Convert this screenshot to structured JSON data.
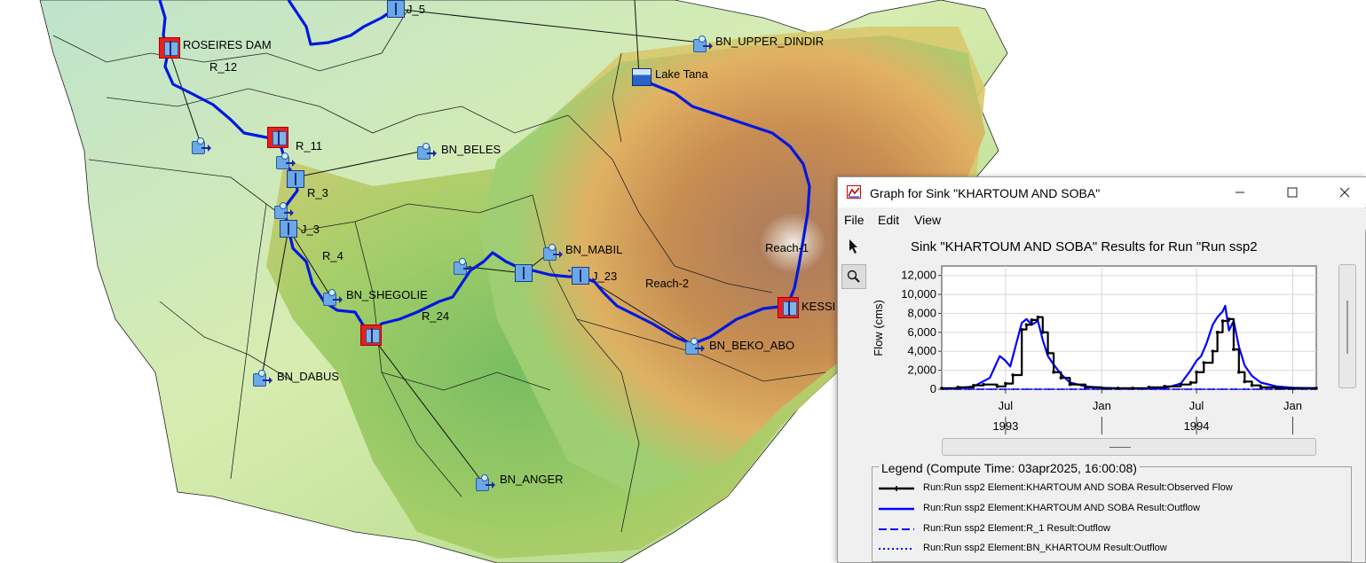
{
  "map": {
    "labels": {
      "roseires_dam": "ROSEIRES DAM",
      "r_12": "R_12",
      "j_5": "J_5",
      "bn_upper_dindir": "BN_UPPER_DINDIR",
      "lake_tana": "Lake Tana",
      "r_11": "R_11",
      "bn_beles": "BN_BELES",
      "r_3": "R_3",
      "j_3": "J_3",
      "r_4": "R_4",
      "bn_shegolie": "BN_SHEGOLIE",
      "r_24": "R_24",
      "bn_mabil": "BN_MABIL",
      "j_23": "J_23",
      "reach_2": "Reach-2",
      "reach_1": "Reach-1",
      "kessie": "KESSI",
      "bn_beko_abo": "BN_BEKO_ABO",
      "bn_dabus": "BN_DABUS",
      "bn_anger": "BN_ANGER"
    }
  },
  "graph_window": {
    "title": "Graph for Sink \"KHARTOUM AND SOBA\"",
    "menu": [
      "File",
      "Edit",
      "View"
    ],
    "chart_title": "Sink \"KHARTOUM AND SOBA\" Results for Run \"Run ssp2",
    "legend_title": "Legend (Compute Time: 03apr2025, 16:00:08)",
    "legend": [
      {
        "label": "Run:Run ssp2 Element:KHARTOUM AND SOBA Result:Observed Flow",
        "color": "#000000",
        "style": "solid-markers"
      },
      {
        "label": "Run:Run ssp2 Element:KHARTOUM AND SOBA Result:Outflow",
        "color": "#0000ff",
        "style": "solid"
      },
      {
        "label": "Run:Run ssp2 Element:R_1 Result:Outflow",
        "color": "#0000ff",
        "style": "dashed"
      },
      {
        "label": "Run:Run ssp2 Element:BN_KHARTOUM Result:Outflow",
        "color": "#0000ff",
        "style": "dotted"
      }
    ]
  },
  "chart_data": {
    "type": "line",
    "title": "Sink \"KHARTOUM AND SOBA\" Results for Run \"Run ssp2",
    "ylabel": "Flow (cms)",
    "ylim": [
      0,
      13000
    ],
    "yticks": [
      0,
      2000,
      4000,
      6000,
      8000,
      10000,
      12000
    ],
    "ytick_labels": [
      "0",
      "2,000",
      "4,000",
      "6,000",
      "8,000",
      "10,000",
      "12,000"
    ],
    "xlim": [
      "1993-03-01",
      "1995-02-15"
    ],
    "xticks": [
      {
        "date": "1993-07-01",
        "label": "Jul",
        "year": "1993"
      },
      {
        "date": "1994-01-01",
        "label": "Jan",
        "year": ""
      },
      {
        "date": "1994-07-01",
        "label": "Jul",
        "year": "1994"
      },
      {
        "date": "1995-01-01",
        "label": "Jan",
        "year": ""
      }
    ],
    "grid": true,
    "series": [
      {
        "name": "Run:Run ssp2 Element:KHARTOUM AND SOBA Result:Observed Flow",
        "color": "#000000",
        "x": [
          "1993-03-01",
          "1993-04-01",
          "1993-05-01",
          "1993-05-20",
          "1993-06-15",
          "1993-07-01",
          "1993-07-15",
          "1993-08-01",
          "1993-08-10",
          "1993-08-20",
          "1993-09-01",
          "1993-09-10",
          "1993-09-20",
          "1993-10-01",
          "1993-10-15",
          "1993-11-01",
          "1993-12-01",
          "1994-01-01",
          "1994-02-01",
          "1994-03-01",
          "1994-04-01",
          "1994-05-01",
          "1994-06-01",
          "1994-06-20",
          "1994-07-01",
          "1994-07-15",
          "1994-08-01",
          "1994-08-10",
          "1994-08-20",
          "1994-09-01",
          "1994-09-10",
          "1994-09-20",
          "1994-10-01",
          "1994-10-15",
          "1994-11-01",
          "1994-12-01",
          "1995-01-01",
          "1995-02-15"
        ],
        "values": [
          100,
          200,
          400,
          500,
          300,
          600,
          1500,
          6300,
          6800,
          7300,
          7600,
          6000,
          3800,
          1800,
          1200,
          500,
          200,
          100,
          100,
          100,
          200,
          300,
          500,
          700,
          1800,
          2800,
          4000,
          6000,
          7200,
          7400,
          4200,
          1800,
          800,
          400,
          200,
          100,
          100,
          100
        ]
      },
      {
        "name": "Run:Run ssp2 Element:KHARTOUM AND SOBA Result:Outflow",
        "color": "#0000ff",
        "x": [
          "1993-03-01",
          "1993-04-01",
          "1993-05-01",
          "1993-06-01",
          "1993-06-20",
          "1993-07-01",
          "1993-07-10",
          "1993-07-20",
          "1993-08-01",
          "1993-08-10",
          "1993-08-20",
          "1993-09-01",
          "1993-09-10",
          "1993-09-20",
          "1993-10-01",
          "1993-10-15",
          "1993-11-01",
          "1993-12-01",
          "1994-01-01",
          "1994-02-01",
          "1994-03-01",
          "1994-04-01",
          "1994-05-01",
          "1994-06-01",
          "1994-06-20",
          "1994-07-01",
          "1994-07-10",
          "1994-07-20",
          "1994-08-01",
          "1994-08-10",
          "1994-08-20",
          "1994-08-25",
          "1994-09-01",
          "1994-09-10",
          "1994-09-20",
          "1994-10-01",
          "1994-10-15",
          "1994-11-01",
          "1994-12-01",
          "1995-01-01",
          "1995-02-15"
        ],
        "values": [
          50,
          100,
          300,
          1200,
          3500,
          3000,
          2400,
          4500,
          7000,
          7400,
          6800,
          7200,
          5200,
          3500,
          2600,
          1600,
          700,
          300,
          150,
          80,
          60,
          60,
          100,
          600,
          2000,
          3000,
          3500,
          4800,
          6800,
          7600,
          8200,
          8800,
          6200,
          7200,
          4500,
          2500,
          1400,
          700,
          300,
          150,
          100
        ]
      },
      {
        "name": "Run:Run ssp2 Element:R_1 Result:Outflow",
        "color": "#0000ff",
        "x": [
          "1993-03-01",
          "1995-02-15"
        ],
        "values": [
          0,
          0
        ]
      },
      {
        "name": "Run:Run ssp2 Element:BN_KHARTOUM Result:Outflow",
        "color": "#0000ff",
        "x": [
          "1993-03-01",
          "1995-02-15"
        ],
        "values": [
          0,
          0
        ]
      }
    ]
  }
}
